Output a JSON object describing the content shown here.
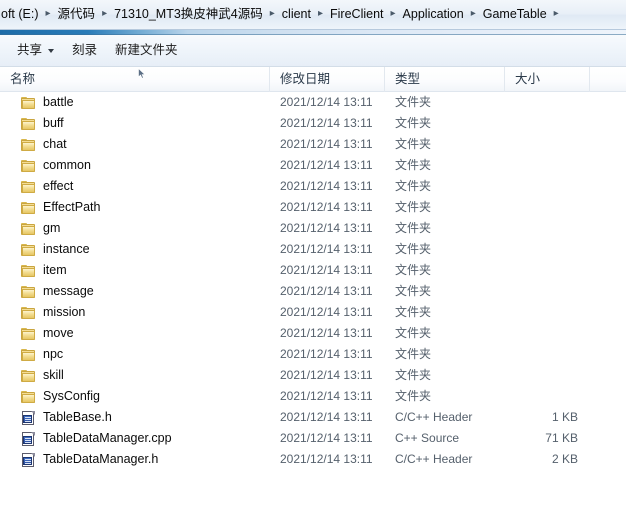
{
  "address_bar": {
    "crumbs": [
      {
        "label": "oft (E:)"
      },
      {
        "label": "源代码"
      },
      {
        "label": "71310_MT3换皮神武4源码"
      },
      {
        "label": "client"
      },
      {
        "label": "FireClient"
      },
      {
        "label": "Application"
      },
      {
        "label": "GameTable"
      }
    ],
    "separator": "▸"
  },
  "toolbar": {
    "share_label": "共享",
    "burn_label": "刻录",
    "new_folder_label": "新建文件夹"
  },
  "columns": {
    "name": "名称",
    "date_modified": "修改日期",
    "type": "类型",
    "size": "大小"
  },
  "colors": {
    "accent_blue": "#1d6ca8",
    "folder_yellow": "#e9c869",
    "doc_badge_blue": "#2d51a0",
    "row_hover": "#e8f2fc",
    "secondary_text": "#55606c"
  },
  "files": [
    {
      "icon": "folder-icon",
      "name": "battle",
      "date": "2021/12/14 13:11",
      "type": "文件夹",
      "size": ""
    },
    {
      "icon": "folder-icon",
      "name": "buff",
      "date": "2021/12/14 13:11",
      "type": "文件夹",
      "size": ""
    },
    {
      "icon": "folder-icon",
      "name": "chat",
      "date": "2021/12/14 13:11",
      "type": "文件夹",
      "size": ""
    },
    {
      "icon": "folder-icon",
      "name": "common",
      "date": "2021/12/14 13:11",
      "type": "文件夹",
      "size": ""
    },
    {
      "icon": "folder-icon",
      "name": "effect",
      "date": "2021/12/14 13:11",
      "type": "文件夹",
      "size": ""
    },
    {
      "icon": "folder-icon",
      "name": "EffectPath",
      "date": "2021/12/14 13:11",
      "type": "文件夹",
      "size": ""
    },
    {
      "icon": "folder-icon",
      "name": "gm",
      "date": "2021/12/14 13:11",
      "type": "文件夹",
      "size": ""
    },
    {
      "icon": "folder-icon",
      "name": "instance",
      "date": "2021/12/14 13:11",
      "type": "文件夹",
      "size": ""
    },
    {
      "icon": "folder-icon",
      "name": "item",
      "date": "2021/12/14 13:11",
      "type": "文件夹",
      "size": ""
    },
    {
      "icon": "folder-icon",
      "name": "message",
      "date": "2021/12/14 13:11",
      "type": "文件夹",
      "size": ""
    },
    {
      "icon": "folder-icon",
      "name": "mission",
      "date": "2021/12/14 13:11",
      "type": "文件夹",
      "size": ""
    },
    {
      "icon": "folder-icon",
      "name": "move",
      "date": "2021/12/14 13:11",
      "type": "文件夹",
      "size": ""
    },
    {
      "icon": "folder-icon",
      "name": "npc",
      "date": "2021/12/14 13:11",
      "type": "文件夹",
      "size": ""
    },
    {
      "icon": "folder-icon",
      "name": "skill",
      "date": "2021/12/14 13:11",
      "type": "文件夹",
      "size": ""
    },
    {
      "icon": "folder-icon",
      "name": "SysConfig",
      "date": "2021/12/14 13:11",
      "type": "文件夹",
      "size": ""
    },
    {
      "icon": "cpp-file-icon",
      "name": "TableBase.h",
      "date": "2021/12/14 13:11",
      "type": "C/C++ Header",
      "size": "1 KB"
    },
    {
      "icon": "cpp-file-icon",
      "name": "TableDataManager.cpp",
      "date": "2021/12/14 13:11",
      "type": "C++ Source",
      "size": "71 KB"
    },
    {
      "icon": "cpp-file-icon",
      "name": "TableDataManager.h",
      "date": "2021/12/14 13:11",
      "type": "C/C++ Header",
      "size": "2 KB"
    }
  ]
}
